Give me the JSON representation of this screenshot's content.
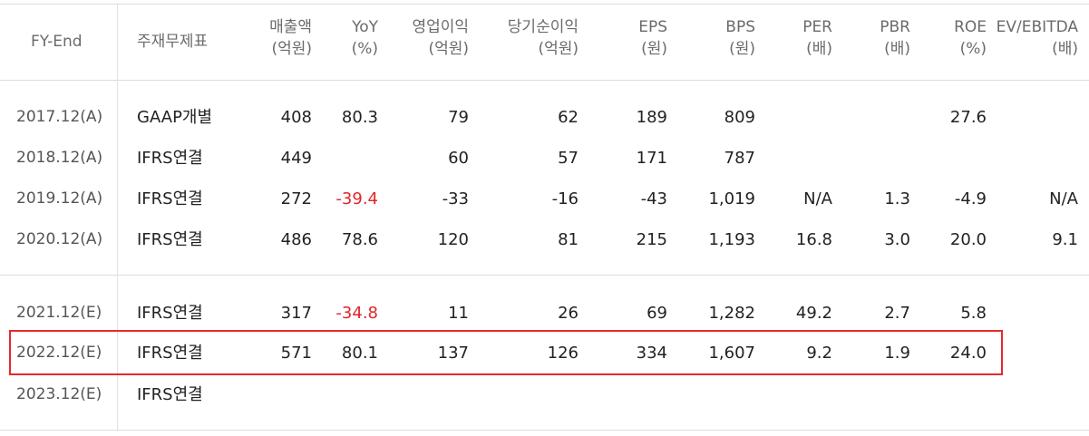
{
  "header": {
    "fy_end": "FY-End",
    "statement": "주재무제표",
    "columns": [
      {
        "l1": "매출액",
        "l2": "(억원)"
      },
      {
        "l1": "YoY",
        "l2": "(%)"
      },
      {
        "l1": "영업이익",
        "l2": "(억원)"
      },
      {
        "l1": "당기순이익",
        "l2": "(억원)"
      },
      {
        "l1": "EPS",
        "l2": "(원)"
      },
      {
        "l1": "BPS",
        "l2": "(원)"
      },
      {
        "l1": "PER",
        "l2": "(배)"
      },
      {
        "l1": "PBR",
        "l2": "(배)"
      },
      {
        "l1": "ROE",
        "l2": "(%)"
      },
      {
        "l1": "EV/EBITDA",
        "l2": "(배)"
      }
    ]
  },
  "rows": [
    {
      "year": "2017.12(A)",
      "statement": "GAAP개별",
      "values": [
        "408",
        "80.3",
        "79",
        "62",
        "189",
        "809",
        "",
        "",
        "27.6",
        ""
      ]
    },
    {
      "year": "2018.12(A)",
      "statement": "IFRS연결",
      "values": [
        "449",
        "",
        "60",
        "57",
        "171",
        "787",
        "",
        "",
        "",
        ""
      ]
    },
    {
      "year": "2019.12(A)",
      "statement": "IFRS연결",
      "values": [
        "272",
        "-39.4",
        "-33",
        "-16",
        "-43",
        "1,019",
        "N/A",
        "1.3",
        "-4.9",
        "N/A"
      ]
    },
    {
      "year": "2020.12(A)",
      "statement": "IFRS연결",
      "values": [
        "486",
        "78.6",
        "120",
        "81",
        "215",
        "1,193",
        "16.8",
        "3.0",
        "20.0",
        "9.1"
      ]
    },
    {
      "year": "2021.12(E)",
      "statement": "IFRS연결",
      "values": [
        "317",
        "-34.8",
        "11",
        "26",
        "69",
        "1,282",
        "49.2",
        "2.7",
        "5.8",
        ""
      ]
    },
    {
      "year": "2022.12(E)",
      "statement": "IFRS연결",
      "values": [
        "571",
        "80.1",
        "137",
        "126",
        "334",
        "1,607",
        "9.2",
        "1.9",
        "24.0",
        ""
      ]
    },
    {
      "year": "2023.12(E)",
      "statement": "IFRS연결",
      "values": [
        "",
        "",
        "",
        "",
        "",
        "",
        "",
        "",
        "",
        ""
      ]
    }
  ],
  "colors": {
    "negative_yoy": "#e0262a",
    "highlight_border": "#e52a2a",
    "rule": "#dcdcdc"
  },
  "highlighted_row": "2022.12(E)"
}
